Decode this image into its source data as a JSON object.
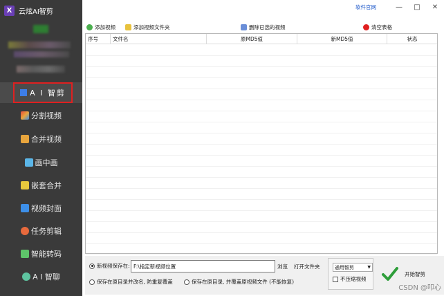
{
  "app": {
    "title": "云炫AI智剪",
    "logo_glyph": "X"
  },
  "window": {
    "site_link": "软件官网",
    "minimize": "—",
    "maximize": "□",
    "close": "✕"
  },
  "sidebar": {
    "active_label": "A I 智剪",
    "items": [
      {
        "label": "分割视频",
        "icon": "split-icon",
        "color": "#e84c3d"
      },
      {
        "label": "合并视频",
        "icon": "merge-icon",
        "color": "#e8a53d"
      },
      {
        "label": "画中画",
        "icon": "pip-icon",
        "color": "#5bb6e8"
      },
      {
        "label": "嵌套合并",
        "icon": "nest-icon",
        "color": "#e8c93d"
      },
      {
        "label": "视频封面",
        "icon": "cover-icon",
        "color": "#3d8fe8"
      },
      {
        "label": "任务剪辑",
        "icon": "task-icon",
        "color": "#e86a3d"
      },
      {
        "label": "智能转码",
        "icon": "transcode-icon",
        "color": "#5ec46a"
      },
      {
        "label": "A I 智聊",
        "icon": "chat-icon",
        "color": "#5ec4a0"
      }
    ]
  },
  "toolbar": {
    "add_video": "添加视频",
    "add_folder": "添加视频文件夹",
    "delete_selected": "删除已选的视频",
    "clear_table": "清空表格"
  },
  "table": {
    "columns": [
      "序号",
      "文件名",
      "原MD5值",
      "新MD5值",
      "状态"
    ],
    "rows": []
  },
  "bottom": {
    "save_label": "新视频保存在:",
    "path_value": "F:\\指定新视频位置",
    "browse": "浏览",
    "open_folder": "打开文件夹",
    "option_rename": "保存在原目录并改名, 防重复覆盖",
    "option_overwrite": "保存在原目录, 并覆盖原视频文件 (不能恢复)",
    "mode_value": "通用智剪",
    "no_compress": "不压缩视频",
    "start": "开始智剪"
  },
  "watermark": "CSDN @叩心"
}
